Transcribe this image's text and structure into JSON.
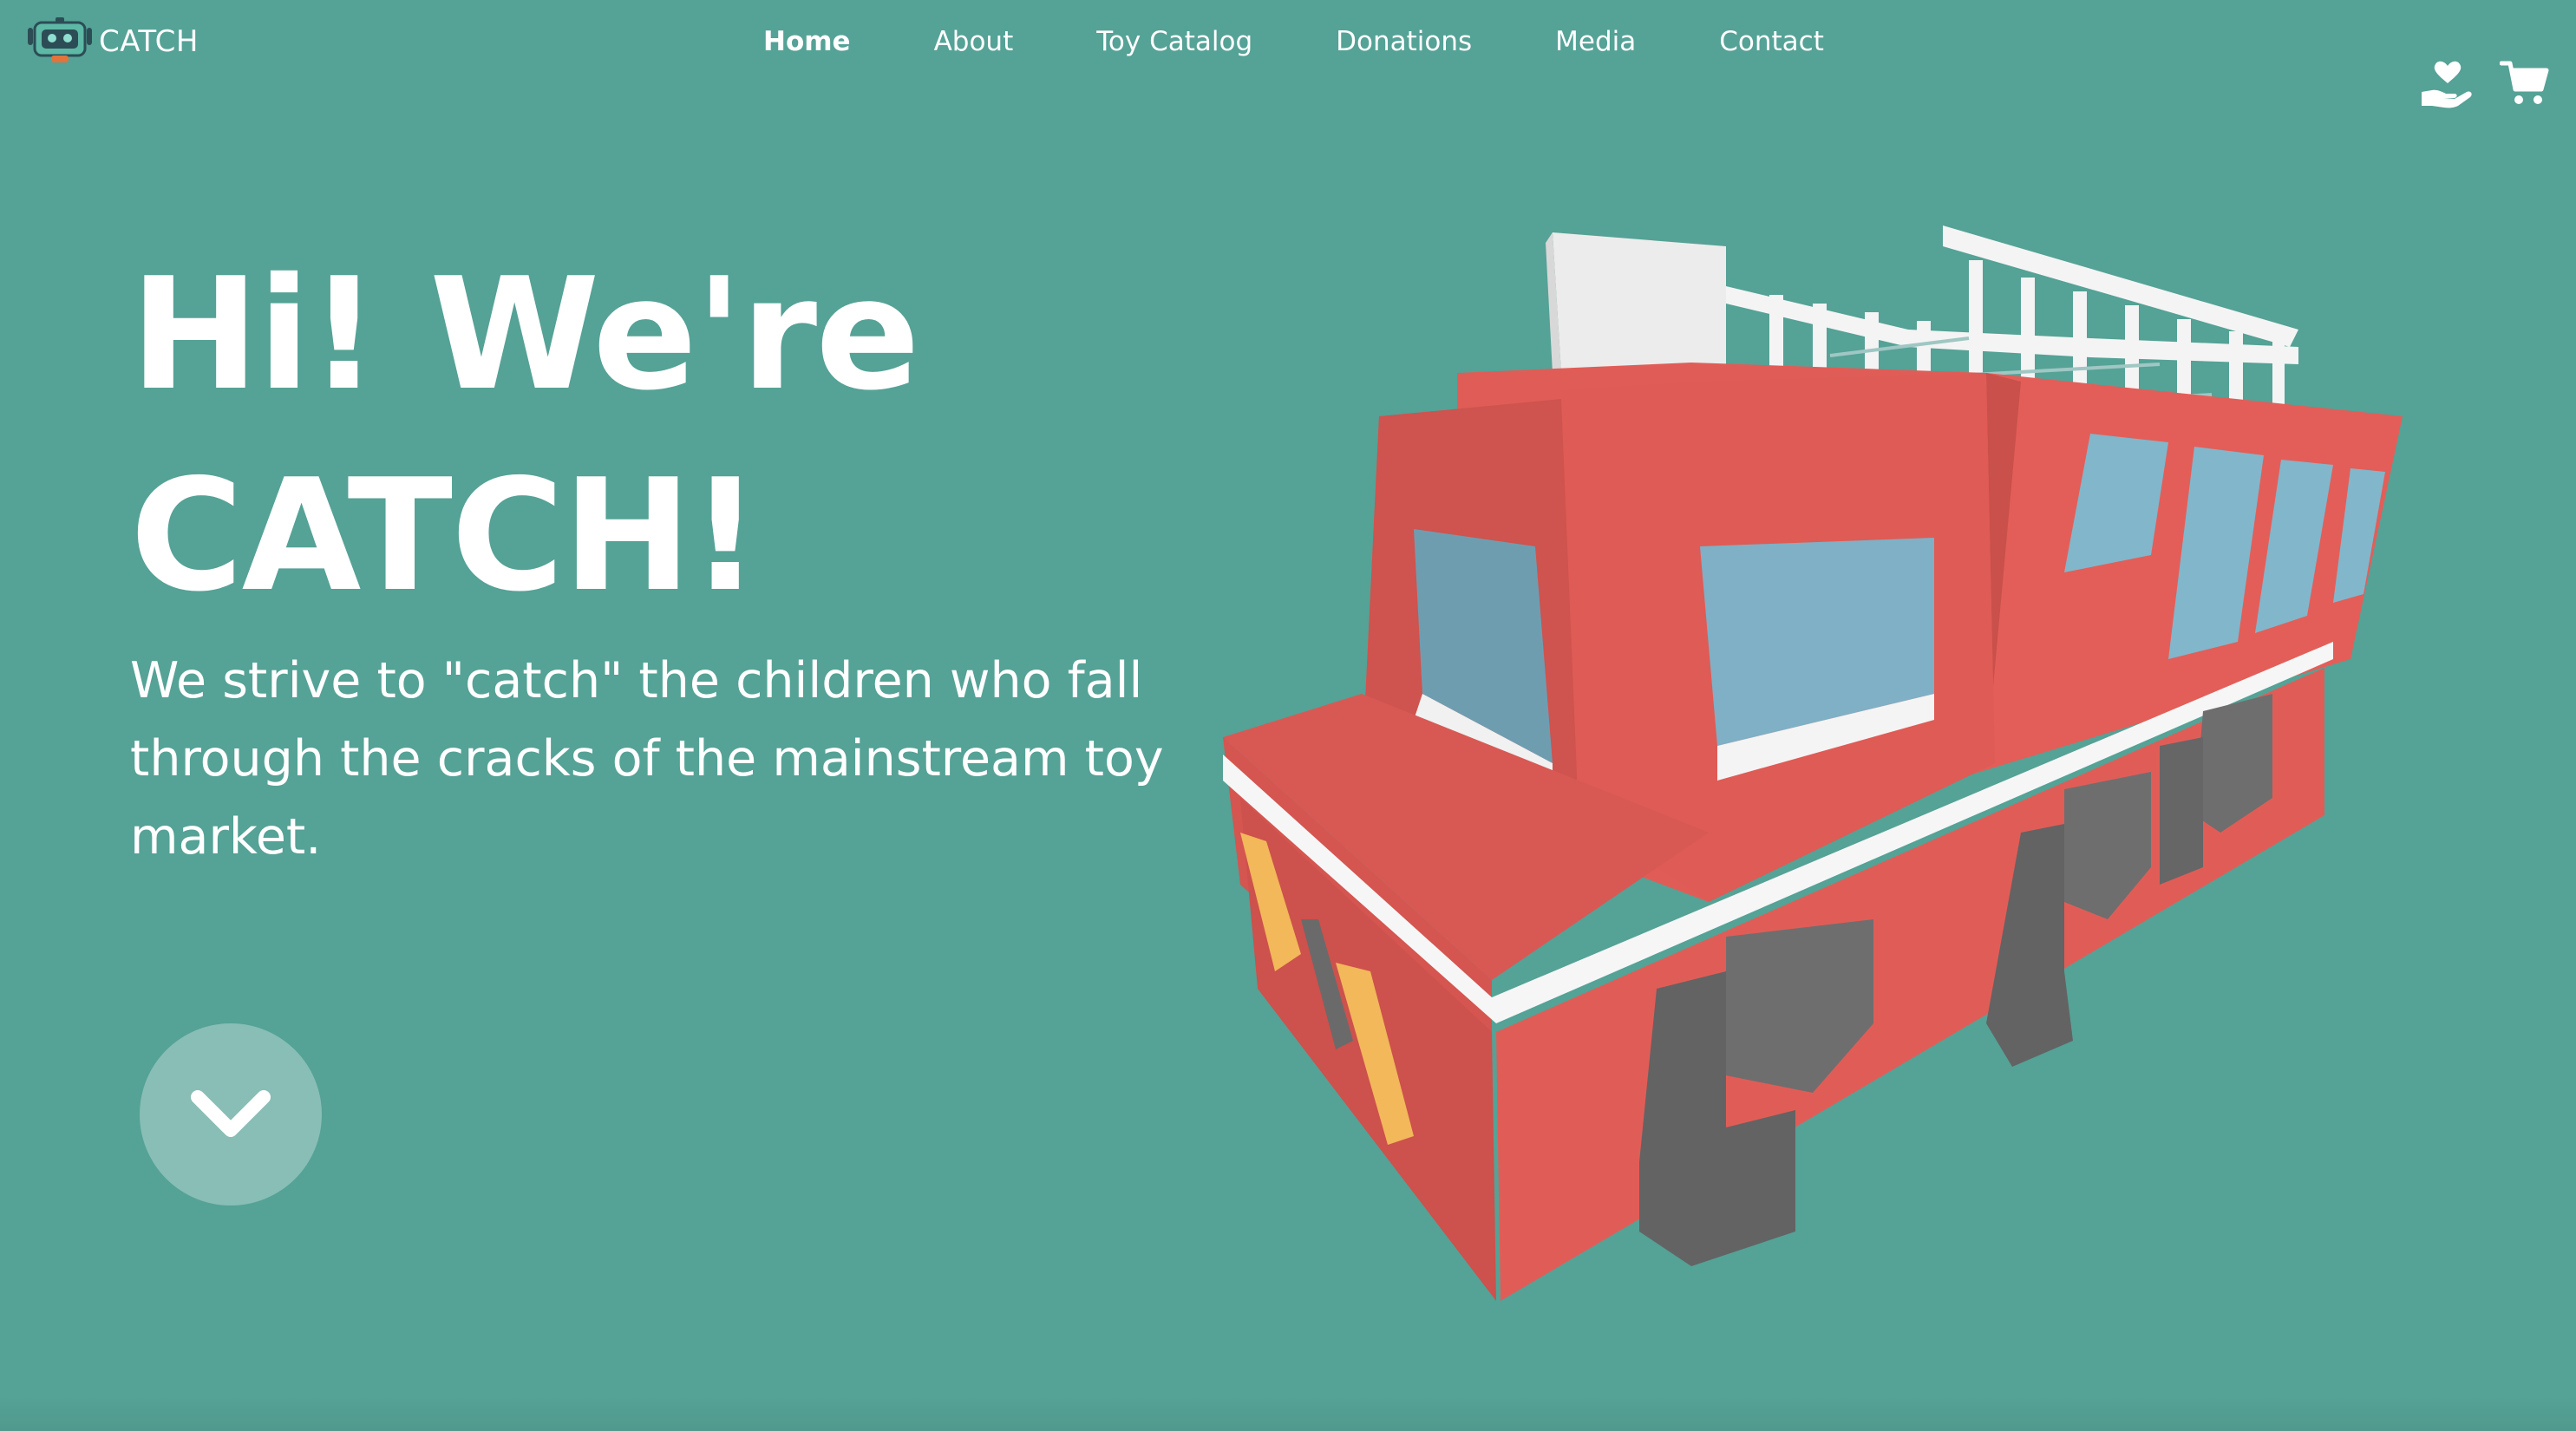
{
  "brand": {
    "name": "CATCH",
    "logo_icon": "robot-head-icon"
  },
  "nav": {
    "items": [
      {
        "label": "Home",
        "active": true
      },
      {
        "label": "About",
        "active": false
      },
      {
        "label": "Toy Catalog",
        "active": false
      },
      {
        "label": "Donations",
        "active": false
      },
      {
        "label": "Media",
        "active": false
      },
      {
        "label": "Contact",
        "active": false
      }
    ]
  },
  "header_icons": {
    "donate": "hand-heart-icon",
    "cart": "cart-icon"
  },
  "hero": {
    "title_line1": "Hi! We're",
    "title_line2": "CATCH!",
    "subtitle": "We strive to \"catch\" the children who fall through the cracks of the mainstream toy market.",
    "scroll_icon": "chevron-down-icon",
    "image": "voxel-fire-truck"
  },
  "colors": {
    "background": "#55a296",
    "text": "#ffffff",
    "truck_red": "#e05d57",
    "truck_window": "#7fb2c8",
    "truck_tire": "#6a6a6a",
    "truck_light": "#f2b85a"
  }
}
